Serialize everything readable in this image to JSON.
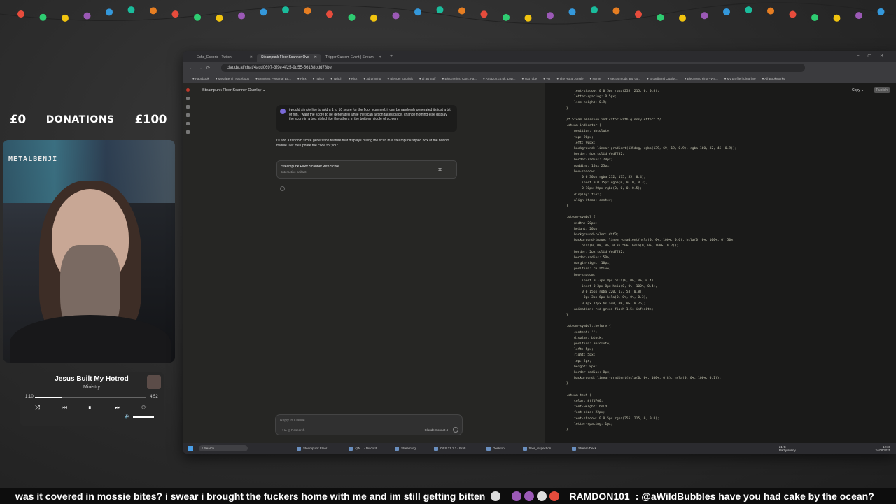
{
  "overlay": {
    "donations": {
      "left": "£0",
      "label": "DONATIONS",
      "right": "£100"
    },
    "webcam_logo": "METALBENJI",
    "music": {
      "title": "Jesus Built My Hotrod",
      "artist": "Ministry",
      "elapsed": "1:10",
      "duration": "4:52",
      "progress": 0.24
    },
    "garland_colors": [
      "#e74c3c",
      "#2ecc71",
      "#f1c40f",
      "#9b59b6",
      "#3498db",
      "#1abc9c",
      "#e67e22"
    ]
  },
  "browser": {
    "tabs": [
      {
        "label": "Echo_Esports - Twitch",
        "active": false
      },
      {
        "label": "Steampunk Floor Scanner Ove",
        "active": true
      },
      {
        "label": "Trigger Custom Event | Stream",
        "active": false
      }
    ],
    "url": "claude.ai/chat/4acd0697-3f9e-4f25-9d55-56168bdd78be",
    "bookmarks": [
      "Facebook",
      "MetalBenji | Facebook",
      "Bentleys Personal Ba...",
      "Plex",
      "Twitch",
      "Twitch",
      "Kick",
      "3d printing",
      "Blender tutorials",
      "ai art stuff",
      "Electronics, Cars, Fa...",
      "Amazon.co.uk: Low...",
      "YouTube",
      "VR",
      "The Rural Jungle",
      "Home",
      "Nexus mods and co...",
      "Broadband Quality...",
      "Electronic First - Wa...",
      "My profile | Clearline",
      "All Bookmarks"
    ],
    "chat": {
      "header": "Steampunk Floor Scanner Overlay ⌄",
      "user_message": "i would simply like to add a 1 to 10 score for the floor scanned, it can be randomly generated its just a bit of fun. i want the score to be generated while the scan action takes place. change nothing else display the score in a box styled like the others in the bottom middle of screen",
      "assistant_message": "I'll add a random score generation feature that displays during the scan in a steampunk-styled box at the bottom middle. Let me update the code for you:",
      "artifact_name": "Steampunk Floor Scanner with Score",
      "artifact_sub": "Interactive artifact",
      "input_placeholder": "Reply to Claude...",
      "tools": "+   ⇆   ◎ Research",
      "model": "Claude Sonnet 4"
    },
    "code_toolbar": {
      "copy": "Copy ⌄",
      "publish": "Publish"
    },
    "code_lines": [
      "    text-shadow: 0 0 5px rgba(255, 215, 0, 0.8);",
      "    letter-spacing: 0.5px;",
      "    line-height: 0.9;",
      "}",
      "",
      "/* Steam emission indicator with glossy effect */",
      ".steam-indicator {",
      "    position: absolute;",
      "    top: 90px;",
      "    left: 90px;",
      "    background: linear-gradient(135deg, rgba(139, 69, 19, 0.9), rgba(160, 82, 45, 0.9));",
      "    border: 4px solid #cd7f32;",
      "    border-radius: 20px;",
      "    padding: 15px 25px;",
      "    box-shadow:",
      "        0 0 30px rgba(212, 175, 55, 0.4),",
      "        inset 0 0 15px rgba(0, 0, 0, 0.3),",
      "        0 10px 20px rgba(0, 0, 0, 0.5);",
      "    display: flex;",
      "    align-items: center;",
      "}",
      "",
      ".steam-symbol {",
      "    width: 20px;",
      "    height: 20px;",
      "    background-color: #ff0;",
      "    background-image: linear-gradient(hsla(0, 0%, 100%, 0.6), hsla(0, 0%, 100%, 0) 50%,",
      "        hsla(0, 0%, 0%, 0.3) 50%, hsla(0, 0%, 100%, 0.2));",
      "    border: 2px solid #cd7f32;",
      "    border-radius: 50%;",
      "    margin-right: 10px;",
      "    position: relative;",
      "    box-shadow:",
      "        inset 0 -3px 8px hsla(0, 0%, 0%, 0.4),",
      "        inset 0 3px 8px hsla(0, 0%, 100%, 0.4),",
      "        0 0 15px rgba(220, 17, 53, 0.8),",
      "        -3px 3px 6px hsla(0, 0%, 0%, 0.3),",
      "        0 0px 12px hsla(0, 0%, 0%, 0.25);",
      "    animation: red-green-flash 1.5s infinite;",
      "}",
      "",
      ".steam-symbol::before {",
      "    content: '';",
      "    display: block;",
      "    position: absolute;",
      "    left: 5px;",
      "    right: 5px;",
      "    top: 2px;",
      "    height: 8px;",
      "    border-radius: 8px;",
      "    background: linear-gradient(hsla(0, 0%, 100%, 0.8), hsla(0, 0%, 100%, 0.1));",
      "}",
      "",
      ".steam-text {",
      "    color: #ffd700;",
      "    font-weight: bold;",
      "    font-size: 22px;",
      "    text-shadow: 0 0 5px rgba(255, 215, 0, 0.8);",
      "    letter-spacing: 1px;",
      "}"
    ],
    "taskbar": {
      "search": "Search",
      "apps": [
        "Steampunk Floor ...",
        "@N... - Discord",
        "Streamfog",
        "OBS 31.1.2 - Profi...",
        "Desktop",
        "floor_inspection...",
        "Stream Deck"
      ],
      "weather_temp": "21°C",
      "weather_desc": "Partly sunny",
      "time": "12:36",
      "date": "24/08/2025"
    }
  },
  "ticker": {
    "message1": "was it covered in mossie bites? i swear i brought the fuckers home with me and im still getting bitten",
    "user2": "RAMDON101",
    "message2": ": @aWildBubbles have you had cake by the ocean?"
  }
}
